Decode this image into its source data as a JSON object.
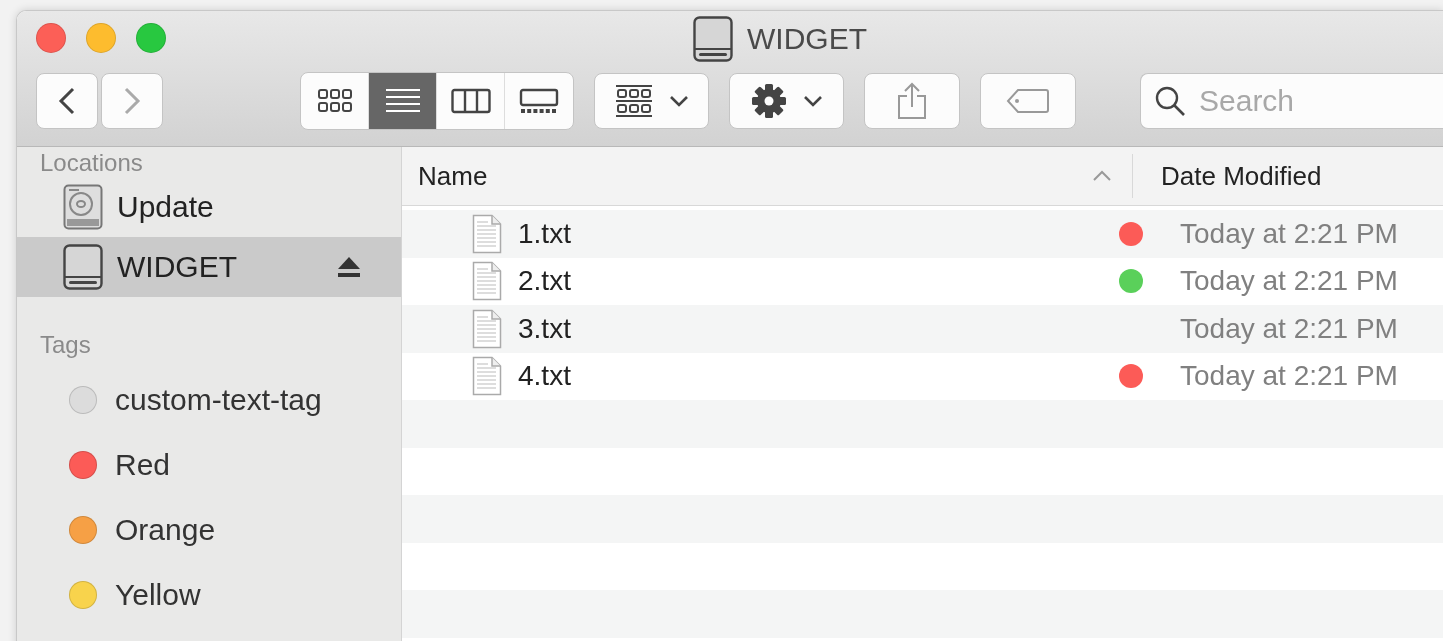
{
  "window": {
    "title": "WIDGET"
  },
  "toolbar": {
    "back": {
      "disabled": false
    },
    "forward": {
      "disabled": true
    },
    "views": [
      {
        "kind": "icons",
        "selected": false
      },
      {
        "kind": "list",
        "selected": true
      },
      {
        "kind": "columns",
        "selected": false
      },
      {
        "kind": "gallery",
        "selected": false
      }
    ],
    "search": {
      "placeholder": "Search"
    }
  },
  "sidebar": {
    "sections": [
      {
        "title": "Locations",
        "items": [
          {
            "kind": "disk",
            "label": "Update",
            "selected": false
          },
          {
            "kind": "drive",
            "label": "WIDGET",
            "selected": true,
            "ejectable": true
          }
        ]
      },
      {
        "title": "Tags",
        "items": [
          {
            "kind": "tag",
            "label": "custom-text-tag",
            "selected": false,
            "color": "#dcdcdc"
          },
          {
            "kind": "tag",
            "label": "Red",
            "selected": false,
            "color": "#fc5b57"
          },
          {
            "kind": "tag",
            "label": "Orange",
            "selected": false,
            "color": "#f6a045"
          },
          {
            "kind": "tag",
            "label": "Yellow",
            "selected": false,
            "color": "#f8d34c"
          }
        ]
      }
    ]
  },
  "table": {
    "columns": [
      {
        "label": "Name",
        "sorted": true
      },
      {
        "label": "Date Modified"
      }
    ],
    "rows": [
      {
        "name": "1.txt",
        "color": "#fc5b57",
        "date": "Today at 2:21 PM"
      },
      {
        "name": "2.txt",
        "color": "#5ad05a",
        "date": "Today at 2:21 PM"
      },
      {
        "name": "3.txt",
        "date": "Today at 2:21 PM"
      },
      {
        "name": "4.txt",
        "color": "#fc5b57",
        "date": "Today at 2:21 PM"
      }
    ]
  }
}
